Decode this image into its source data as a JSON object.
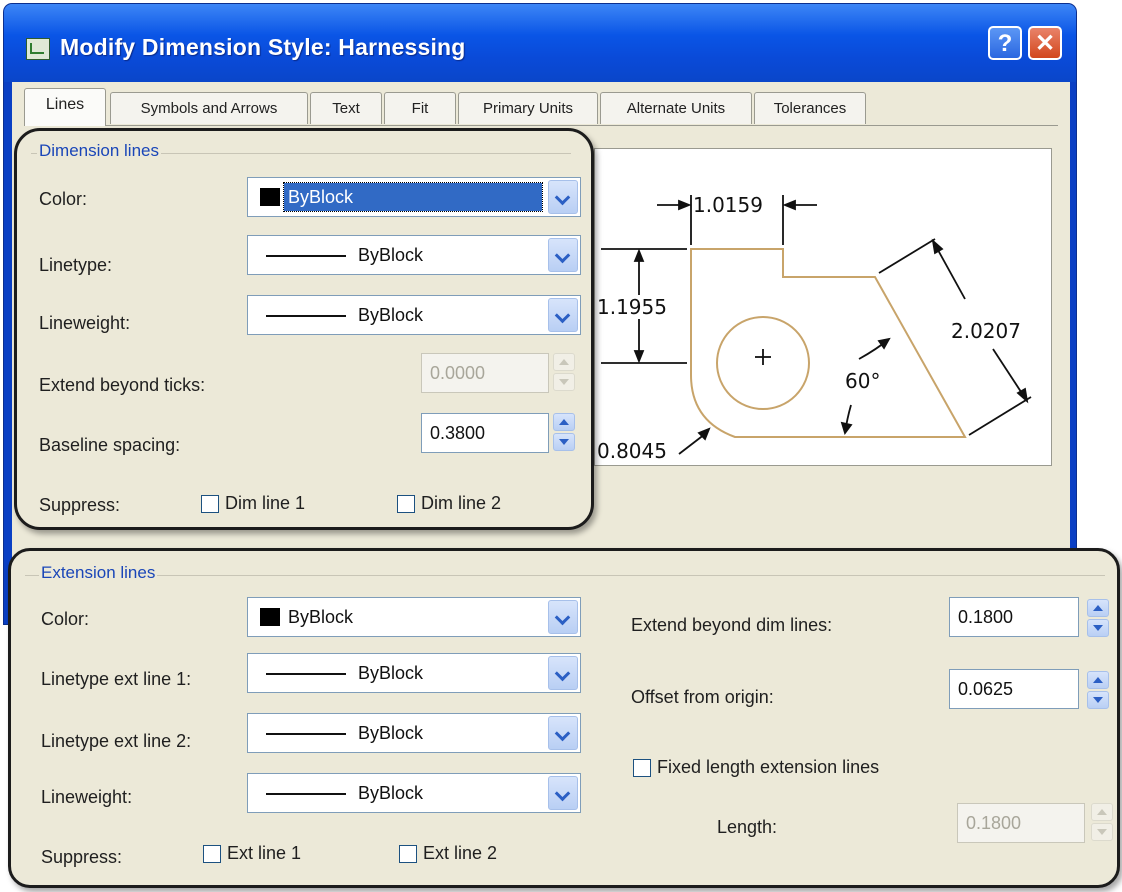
{
  "window": {
    "title": "Modify Dimension Style: Harnessing",
    "help_label": "?",
    "close_label": "✕"
  },
  "tabs": [
    {
      "label": "Lines",
      "active": true
    },
    {
      "label": "Symbols and Arrows"
    },
    {
      "label": "Text"
    },
    {
      "label": "Fit"
    },
    {
      "label": "Primary Units"
    },
    {
      "label": "Alternate Units"
    },
    {
      "label": "Tolerances"
    }
  ],
  "preview": {
    "labels": [
      "1.0159",
      "1.1955",
      "2.0207",
      "60°",
      "0.8045"
    ]
  },
  "dimension_lines": {
    "title": "Dimension lines",
    "color_label": "Color:",
    "color_value": "ByBlock",
    "linetype_label": "Linetype:",
    "linetype_value": "ByBlock",
    "lineweight_label": "Lineweight:",
    "lineweight_value": "ByBlock",
    "extend_label": "Extend beyond ticks:",
    "extend_value": "0.0000",
    "baseline_label": "Baseline spacing:",
    "baseline_value": "0.3800",
    "suppress_label": "Suppress:",
    "dim_line1": "Dim line 1",
    "dim_line2": "Dim line 2"
  },
  "extension_lines": {
    "title": "Extension lines",
    "color_label": "Color:",
    "color_value": "ByBlock",
    "linetype1_label": "Linetype ext line 1:",
    "linetype1_value": "ByBlock",
    "linetype2_label": "Linetype ext line 2:",
    "linetype2_value": "ByBlock",
    "lineweight_label": "Lineweight:",
    "lineweight_value": "ByBlock",
    "suppress_label": "Suppress:",
    "ext_line1": "Ext line 1",
    "ext_line2": "Ext line 2",
    "extend_label": "Extend beyond dim lines:",
    "extend_value": "0.1800",
    "offset_label": "Offset from origin:",
    "offset_value": "0.0625",
    "fixed_label": "Fixed length extension lines",
    "length_label": "Length:",
    "length_value": "0.1800"
  },
  "colors": {
    "title_bar": "#0a55e6",
    "dialog_bg": "#ece9d8",
    "group_title": "#1a46b8",
    "selection": "#316ac5",
    "preview_geometry": "#c8a46a"
  }
}
